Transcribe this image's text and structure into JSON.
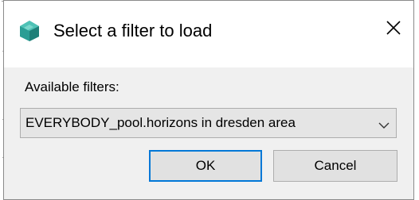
{
  "dialog": {
    "title": "Select a filter to load",
    "app_icon": "teal-cube-icon",
    "close_icon": "close-icon",
    "available_label": "Available filters:",
    "filter_select": {
      "selected": "EVERYBODY_pool.horizons in dresden area",
      "arrow_icon": "chevron-down-icon"
    },
    "buttons": {
      "ok": "OK",
      "cancel": "Cancel"
    }
  },
  "colors": {
    "title_bar": "#ffffff",
    "dialog_body": "#f0f0f0",
    "button_face": "#e1e1e1",
    "default_button_border": "#0078d7",
    "icon_teal": "#2a9d94"
  }
}
